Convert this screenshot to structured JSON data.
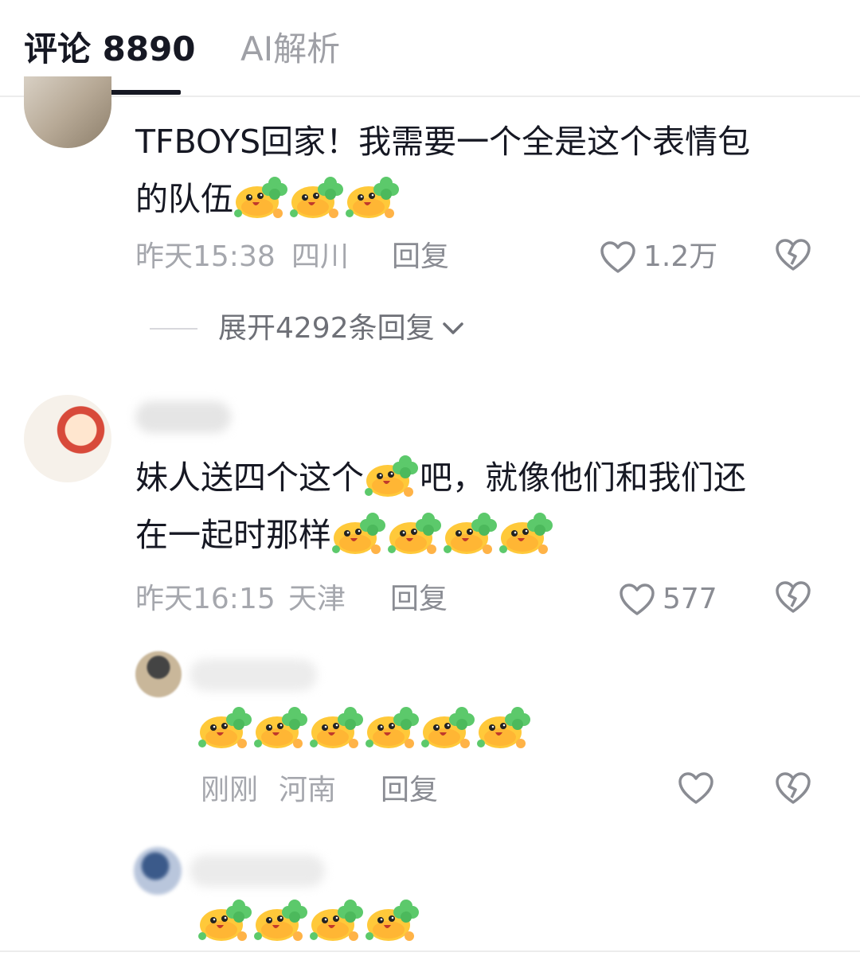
{
  "tabs": {
    "comments": "评论 8890",
    "ai": "AI解析"
  },
  "comments": [
    {
      "text": "TFBOYS回家！我需要一个全是这个表情包的队伍",
      "text_line1": "TFBOYS回家！我需要一个全是这个表情包",
      "text_line2": "的队伍",
      "emoji_count": 3,
      "time": "昨天15:38",
      "location": "四川",
      "reply_label": "回复",
      "likes": "1.2万",
      "expand_label": "展开4292条回复"
    },
    {
      "text_line1a": "妹人送四个这个",
      "text_line1b": "吧，就像他们和我们还",
      "text_line2": "在一起时那样",
      "emoji_count": 5,
      "time": "昨天16:15",
      "location": "天津",
      "reply_label": "回复",
      "likes": "577"
    },
    {
      "emoji_count": 6,
      "time": "刚刚",
      "location": "河南",
      "reply_label": "回复",
      "likes": ""
    },
    {
      "emoji_count": 4
    }
  ],
  "colors": {
    "text": "#161823",
    "muted": "#a5a7ad",
    "emoji_yellow": "#ffc93a",
    "emoji_green": "#5cc96b"
  },
  "icons": [
    "heart-outline-icon",
    "broken-heart-icon",
    "chevron-down-icon",
    "clover-duck-emoji"
  ]
}
